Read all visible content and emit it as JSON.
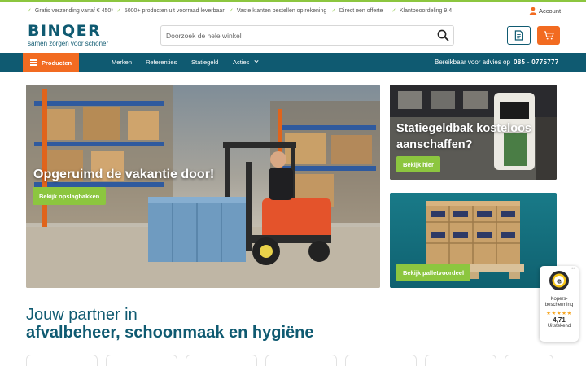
{
  "usp_bar": {
    "items": [
      "Gratis verzending vanaf € 450*",
      "5000+ producten uit voorraad leverbaar",
      "Vaste klanten bestellen op rekening",
      "Direct een offerte",
      "Klantbeoordeling 9,4"
    ],
    "account_label": "Account"
  },
  "header": {
    "logo_word": "BINQER",
    "logo_tagline": "samen zorgen voor schoner",
    "search_placeholder": "Doorzoek de hele winkel"
  },
  "nav": {
    "products_label": "Producten",
    "items": [
      "Merken",
      "Referenties",
      "Statiegeld",
      "Acties"
    ],
    "contact_label": "Bereikbaar voor advies op",
    "contact_phone": "085 - 0775777"
  },
  "banners": {
    "main": {
      "title": "Opgeruimd de vakantie door!",
      "button": "Bekijk opslagbakken"
    },
    "top_right": {
      "title_line1": "Statiegeldbak kosteloos",
      "title_line2": "aanschaffen?",
      "button": "Bekijk hier"
    },
    "bottom_right": {
      "button": "Bekijk palletvoordeel"
    }
  },
  "hero": {
    "line1": "Jouw partner in",
    "line2": "afvalbeheer, schoonmaak en hygiëne"
  },
  "trust_badge": {
    "label": "Kopers-bescherming",
    "stars": "★★★★★",
    "score": "4,71",
    "rating_text": "Uitstekend",
    "menu": "•••"
  },
  "colors": {
    "primary": "#0f5a71",
    "accent_orange": "#f26b21",
    "accent_green": "#8cc63f"
  },
  "icons": {
    "account": "user-icon",
    "search": "search-icon",
    "quote": "document-icon",
    "cart": "cart-icon",
    "menu": "hamburger-icon",
    "dropdown": "chevron-down-icon",
    "check": "check-icon"
  }
}
